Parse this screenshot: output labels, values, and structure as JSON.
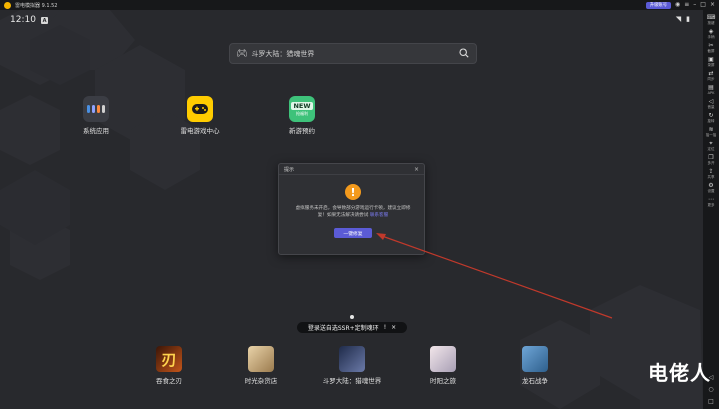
{
  "window": {
    "title": "雷电模拟器 9.1.52",
    "badge": "升级账号",
    "controls": [
      "avatar-icon",
      "menu-icon",
      "minimize-icon",
      "maximize-icon",
      "close-icon"
    ]
  },
  "statusbar": {
    "time": "12:10",
    "notification": "A"
  },
  "search": {
    "text": "斗罗大陆：猎魂世界",
    "icon_left": "gamepad-icon",
    "icon_right": "search-icon"
  },
  "apps": [
    {
      "label": "系统应用",
      "icon": "folder-icon"
    },
    {
      "label": "雷电游戏中心",
      "icon": "gamepad-icon"
    },
    {
      "label": "新游预约",
      "icon": "new-badge-icon",
      "badge_top": "NEW",
      "badge_bottom": "抢福利"
    }
  ],
  "dialog": {
    "title": "提示",
    "message": "虚拟服务未开启，会导致部分游戏运行卡顿，建议立即修复！如果无法解决请尝试",
    "link": "联系客服",
    "button": "一键修复"
  },
  "promo": {
    "text": "登录送自选SSR+定制魂环",
    "exclaim": "!",
    "close": "×"
  },
  "dock": [
    {
      "label": "吞食之刃",
      "glyph": "刃"
    },
    {
      "label": "时光杂货店"
    },
    {
      "label": "斗罗大陆：猎魂世界"
    },
    {
      "label": "时阳之旅"
    },
    {
      "label": "龙石战争"
    }
  ],
  "sidebar": {
    "items": [
      {
        "icon": "keyboard-icon",
        "label": "按键"
      },
      {
        "icon": "gamepad-icon",
        "label": "手柄"
      },
      {
        "icon": "scissors-icon",
        "label": "截屏"
      },
      {
        "icon": "record-icon",
        "label": "录屏"
      },
      {
        "icon": "sync-icon",
        "label": "同步"
      },
      {
        "icon": "apk-icon",
        "label": "APK"
      },
      {
        "icon": "volume-icon",
        "label": "音量"
      },
      {
        "icon": "rotate-icon",
        "label": "旋转"
      },
      {
        "icon": "shake-icon",
        "label": "摇一摇"
      },
      {
        "icon": "location-icon",
        "label": "定位"
      },
      {
        "icon": "multi-icon",
        "label": "多开"
      },
      {
        "icon": "share-icon",
        "label": "共享"
      },
      {
        "icon": "settings-icon",
        "label": "设置"
      },
      {
        "icon": "more-icon",
        "label": "更多"
      }
    ],
    "bottom": [
      "back-icon",
      "home-icon",
      "recent-icon"
    ]
  },
  "watermark": "电佬人",
  "colors": {
    "accent": "#5b5bd6",
    "warning": "#f39a1d",
    "background": "#28292d",
    "annotation_arrow": "#c0392b"
  }
}
